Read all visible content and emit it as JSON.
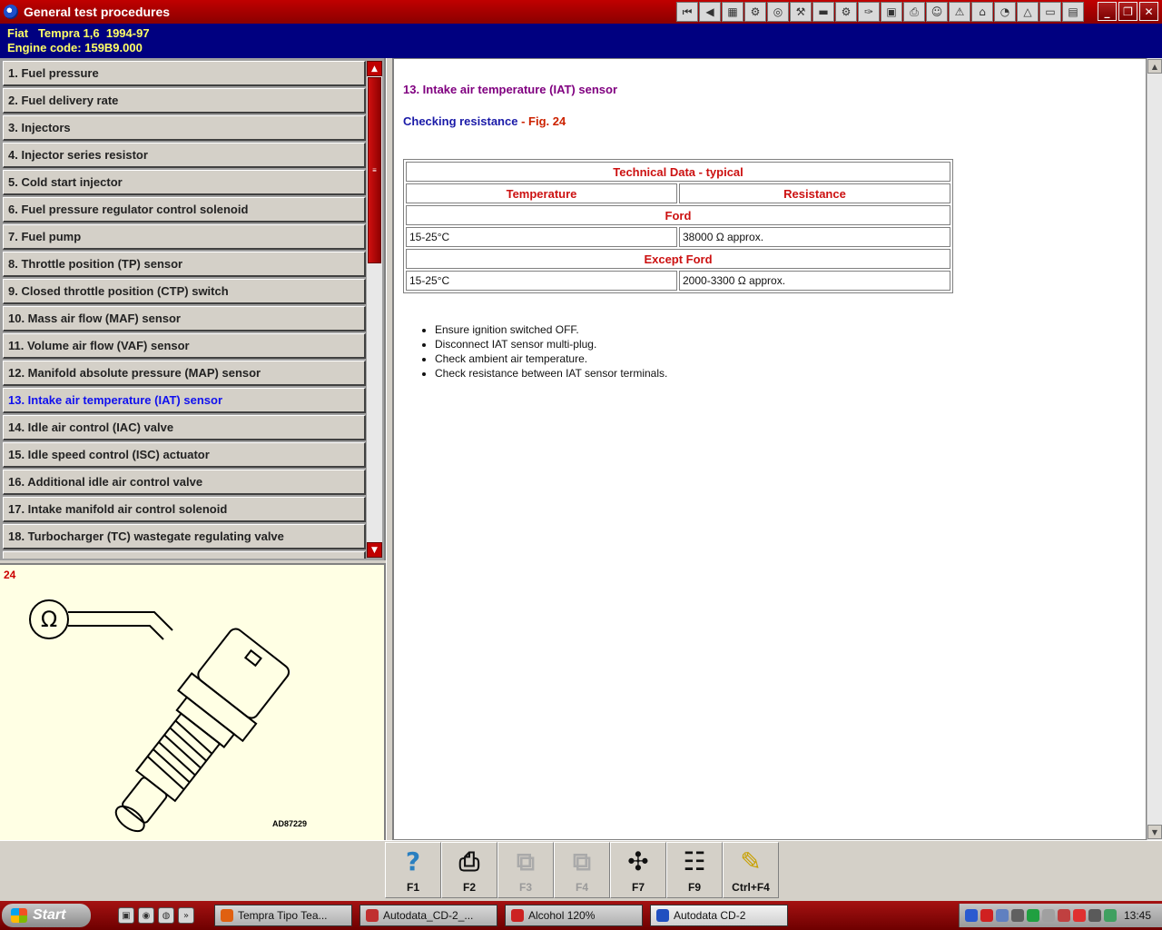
{
  "window": {
    "title": "General test procedures",
    "toolbar_icons": [
      "first-icon",
      "prev-icon",
      "map-icon",
      "engine-icon",
      "wheel-icon",
      "tools-icon",
      "car-icon",
      "gear-icon",
      "spanner-icon",
      "chip-icon",
      "printer-icon",
      "mechanic-icon",
      "service-icon",
      "shop-icon",
      "meter-icon",
      "warning-icon",
      "battery-icon",
      "book-icon"
    ],
    "controls": {
      "minimize": "_",
      "restore": "❐",
      "close": "✕"
    }
  },
  "vehicle": {
    "line1": "Fiat   Tempra 1,6  1994-97",
    "line2": "Engine code: 159B9.000"
  },
  "procedures": [
    {
      "label": "1. Fuel pressure"
    },
    {
      "label": "2. Fuel delivery rate"
    },
    {
      "label": "3. Injectors"
    },
    {
      "label": "4. Injector series resistor"
    },
    {
      "label": "5. Cold start injector"
    },
    {
      "label": "6. Fuel pressure regulator control solenoid"
    },
    {
      "label": "7. Fuel pump"
    },
    {
      "label": "8. Throttle position (TP) sensor"
    },
    {
      "label": "9. Closed throttle position (CTP) switch"
    },
    {
      "label": "10. Mass air flow (MAF) sensor"
    },
    {
      "label": "11. Volume air flow (VAF) sensor"
    },
    {
      "label": "12. Manifold absolute pressure (MAP) sensor"
    },
    {
      "label": "13. Intake air temperature (IAT) sensor",
      "active": true
    },
    {
      "label": "14. Idle air control (IAC) valve"
    },
    {
      "label": "15. Idle speed control (ISC) actuator"
    },
    {
      "label": "16. Additional idle air control valve"
    },
    {
      "label": "17. Intake manifold air control solenoid"
    },
    {
      "label": "18. Turbocharger (TC) wastegate regulating valve"
    }
  ],
  "figure": {
    "number": "24",
    "ohm_symbol": "Ω",
    "code": "AD87229"
  },
  "content": {
    "section_title": "13. Intake air temperature (IAT) sensor",
    "subtitle_main": "Checking resistance",
    "subtitle_sep": " - ",
    "subtitle_fig": "Fig. 24",
    "table": {
      "title": "Technical Data - typical",
      "col1": "Temperature",
      "col2": "Resistance",
      "groups": [
        {
          "name": "Ford",
          "temp": "15-25°C",
          "resistance": "38000 Ω approx."
        },
        {
          "name": "Except Ford",
          "temp": "15-25°C",
          "resistance": "2000-3300 Ω approx."
        }
      ]
    },
    "steps": [
      "Ensure ignition switched OFF.",
      "Disconnect IAT sensor multi-plug.",
      "Check ambient air temperature.",
      "Check resistance between IAT sensor terminals."
    ]
  },
  "fkeys": [
    {
      "label": "F1",
      "icon": "help-icon",
      "glyph": "?",
      "enabled": true
    },
    {
      "label": "F2",
      "icon": "print-icon",
      "glyph": "⎙",
      "enabled": true
    },
    {
      "label": "F3",
      "icon": "image-icon",
      "glyph": "⧉",
      "enabled": false
    },
    {
      "label": "F4",
      "icon": "images-icon",
      "glyph": "⧉",
      "enabled": false
    },
    {
      "label": "F7",
      "icon": "compass-icon",
      "glyph": "✣",
      "enabled": true
    },
    {
      "label": "F9",
      "icon": "table-icon",
      "glyph": "☷",
      "enabled": true
    },
    {
      "label": "Ctrl+F4",
      "icon": "pencil-icon",
      "glyph": "✎",
      "enabled": true
    }
  ],
  "taskbar": {
    "start": "Start",
    "tasks": [
      {
        "label": "Tempra Tipo Tea...",
        "color": "#e06010"
      },
      {
        "label": "Autodata_CD-2_...",
        "color": "#c03030"
      },
      {
        "label": "Alcohol 120%",
        "color": "#cc2222"
      },
      {
        "label": "Autodata CD-2",
        "color": "#2050c0",
        "active": true
      }
    ],
    "clock": "13:45"
  }
}
